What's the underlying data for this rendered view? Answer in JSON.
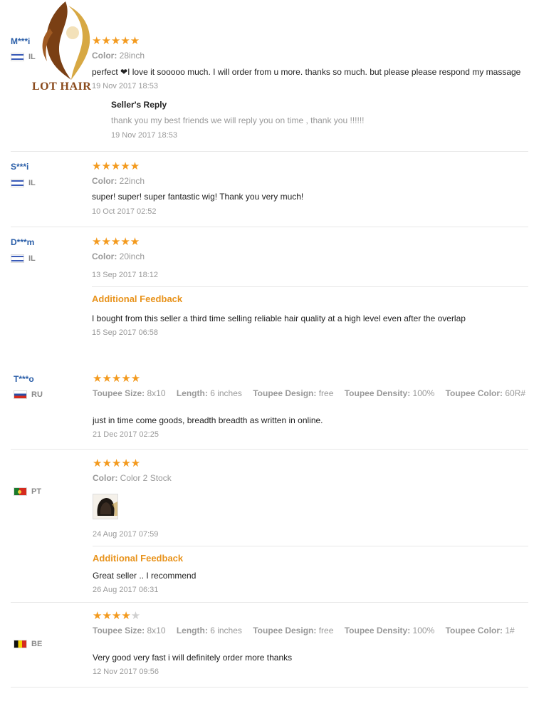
{
  "brand": {
    "name": "LOT HAIR"
  },
  "colors": {
    "star": "#f39a1e",
    "feedback_orange": "#e8931c",
    "user_blue": "#2a5ea8"
  },
  "reviews": [
    {
      "user": "M***i",
      "country": "IL",
      "rating": 5,
      "attrs": [
        {
          "label": "Color:",
          "value": "28inch"
        }
      ],
      "text": "perfect ❤I love it sooooo much. I will order from u more. thanks so much. but please please respond my massage",
      "date": "19 Nov 2017 18:53",
      "reply": {
        "title": "Seller's Reply",
        "text": "thank you my best friends we will reply you on time , thank you !!!!!!",
        "date": "19 Nov 2017 18:53"
      }
    },
    {
      "user": "S***i",
      "country": "IL",
      "rating": 5,
      "attrs": [
        {
          "label": "Color:",
          "value": "22inch"
        }
      ],
      "text": "super! super! super fantastic wig! Thank you very much!",
      "date": "10 Oct 2017 02:52"
    },
    {
      "user": "D***m",
      "country": "IL",
      "rating": 5,
      "attrs": [
        {
          "label": "Color:",
          "value": "20inch"
        }
      ],
      "date": "13 Sep 2017 18:12",
      "additional": {
        "title": "Additional Feedback",
        "text": "I bought from this seller a third time selling reliable hair quality at a high level even after the overlap",
        "date": "15 Sep 2017 06:58"
      }
    },
    {
      "user": "T***o",
      "country": "RU",
      "rating": 5,
      "attrs": [
        {
          "label": "Toupee Size:",
          "value": "8x10"
        },
        {
          "label": "Length:",
          "value": "6 inches"
        },
        {
          "label": "Toupee Design:",
          "value": "free"
        },
        {
          "label": "Toupee Density:",
          "value": "100%"
        },
        {
          "label": "Toupee Color:",
          "value": "60R#"
        }
      ],
      "text": "just in time come goods, breadth breadth as written in online.",
      "date": "21 Dec 2017 02:25"
    },
    {
      "user": "",
      "country": "PT",
      "rating": 5,
      "attrs": [
        {
          "label": "Color:",
          "value": "Color 2 Stock"
        }
      ],
      "date": "24 Aug 2017 07:59",
      "additional": {
        "title": "Additional Feedback",
        "text": "Great seller .. I recommend",
        "date": "26 Aug 2017 06:31"
      }
    },
    {
      "user": "",
      "country": "BE",
      "rating": 4,
      "attrs": [
        {
          "label": "Toupee Size:",
          "value": "8x10"
        },
        {
          "label": "Length:",
          "value": "6 inches"
        },
        {
          "label": "Toupee Design:",
          "value": "free"
        },
        {
          "label": "Toupee Density:",
          "value": "100%"
        },
        {
          "label": "Toupee Color:",
          "value": "1#"
        }
      ],
      "text": "Very good very fast i will definitely order more thanks",
      "date": "12 Nov 2017 09:56"
    }
  ]
}
